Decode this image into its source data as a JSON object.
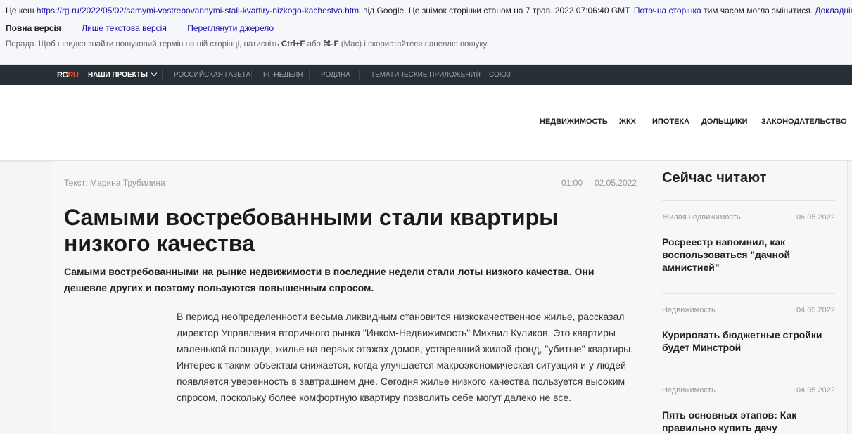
{
  "cache": {
    "prefix": "Це кеш",
    "url": "https://rg.ru/2022/05/02/samymi-vostrebovannymi-stali-kvartiry-nizkogo-kachestva.html",
    "middle": "від Google. Це знімок сторінки станом на 7 трав. 2022 07:06:40 GMT.",
    "current_page": "Поточна сторінка",
    "after_current": "тим часом могла змінитися.",
    "more": "Докладніше.",
    "full_version": "Повна версія",
    "text_only": "Лише текстова версія",
    "view_source": "Переглянути джерело",
    "tip_start": "Порада. Щоб швидко знайти пошуковий термін на цій сторінці, натисніть",
    "tip_keys": "Ctrl+F",
    "tip_or": "або",
    "tip_mac_keys": "⌘-F",
    "tip_end": "(Mac) і скористайтеся панеллю пошуку."
  },
  "topnav": {
    "logo_rg": "RG",
    "logo_ru": "RU",
    "projects": "НАШИ ПРОЕКТЫ",
    "items": [
      "РОССИЙСКАЯ ГАЗЕТА",
      "РГ-НЕДЕЛЯ",
      "РОДИНА",
      "ТЕМАТИЧЕСКИЕ ПРИЛОЖЕНИЯ",
      "СОЮЗ"
    ]
  },
  "sections": [
    "НЕДВИЖИМОСТЬ",
    "ЖКХ",
    "ИПОТЕКА",
    "ДОЛЬЩИКИ",
    "ЗАКОНОДАТЕЛЬСТВО"
  ],
  "article": {
    "author_label": "Текст:",
    "author": "Марина Трубилина",
    "time": "01:00",
    "date": "02.05.2022",
    "title": "Самыми востребованными стали квартиры низкого качества",
    "lead": "Самыми востребованными на рынке недвижимости в последние недели стали лоты низкого качества. Они дешевле других и поэтому пользуются повышенным спросом.",
    "body": "В период неопределенности весьма ликвидным становится низкокачественное жилье, рассказал директор Управления вторичного рынка \"Инком-Недвижимость\" Михаил Куликов. Это квартиры маленькой площади, жилье на первых этажах домов, устаревший жилой фонд, \"убитые\" квартиры. Интерес к таким объектам снижается, когда улучшается макроэкономическая ситуация и у людей появляется уверенность в завтрашнем дне. Сегодня жилье низкого качества пользуется высоким спросом, поскольку более комфортную квартиру позволить себе могут далеко не все."
  },
  "sidebar": {
    "title": "Сейчас читают",
    "news": [
      {
        "rubric": "Жилая недвижимость",
        "date": "06.05.2022",
        "title": "Росреестр напомнил, как воспользоваться \"дачной амнистией\""
      },
      {
        "rubric": "Недвижимость",
        "date": "04.05.2022",
        "title": "Курировать бюджетные стройки будет Минстрой"
      },
      {
        "rubric": "Недвижимость",
        "date": "04.05.2022",
        "title": "Пять основных этапов: Как правильно купить дачу"
      }
    ]
  },
  "colors": {
    "link": "#1a0dab",
    "topnav_bg": "#262f35",
    "logo_accent": "#e8542f"
  }
}
